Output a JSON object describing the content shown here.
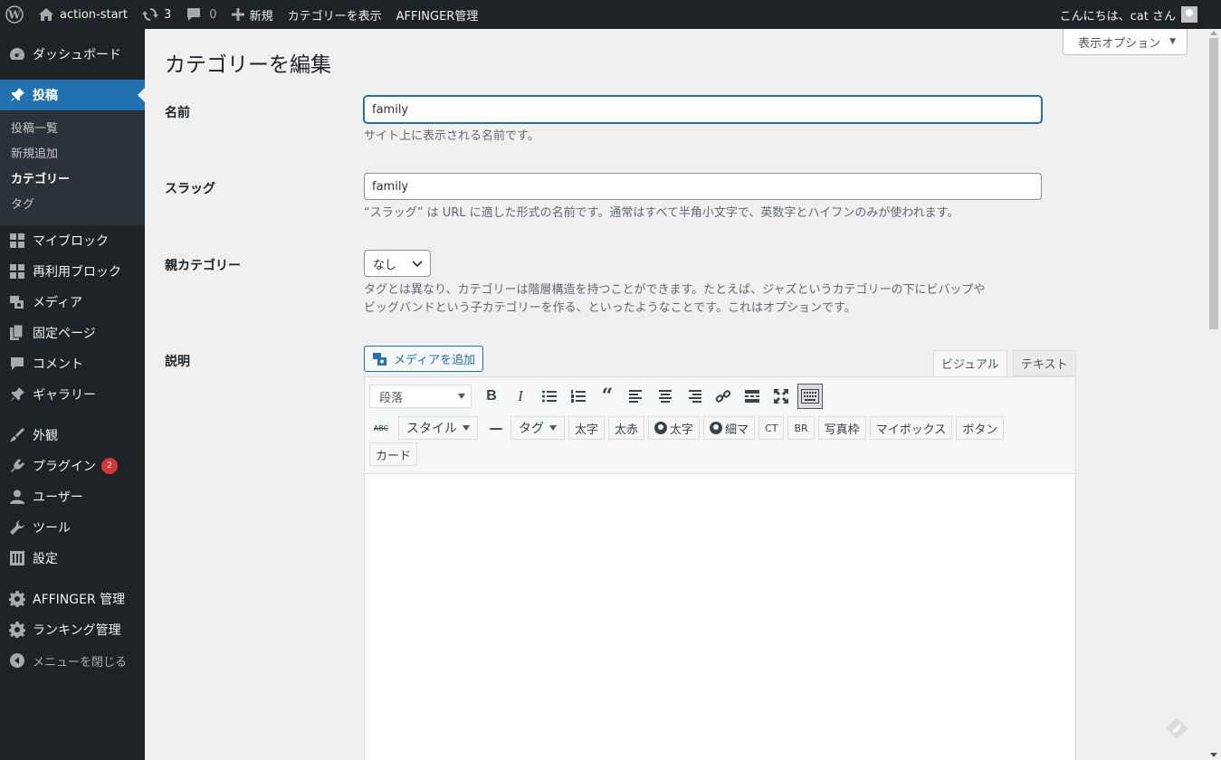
{
  "adminbar": {
    "site_name": "action-start",
    "updates_count": "3",
    "comments_count": "0",
    "new_label": "新規",
    "view_category": "カテゴリーを表示",
    "affinger": "AFFINGER管理",
    "greeting": "こんにちは、cat さん"
  },
  "sidebar": {
    "dashboard": "ダッシュボード",
    "posts": "投稿",
    "sub": {
      "all_posts": "投稿一覧",
      "add_new": "新規追加",
      "categories": "カテゴリー",
      "tags": "タグ"
    },
    "my_blocks": "マイブロック",
    "reusable_blocks": "再利用ブロック",
    "media": "メディア",
    "pages": "固定ページ",
    "comments": "コメント",
    "gallery": "ギャラリー",
    "appearance": "外観",
    "plugins": "プラグイン",
    "plugins_badge": "2",
    "users": "ユーザー",
    "tools": "ツール",
    "settings": "設定",
    "affinger": "AFFINGER 管理",
    "ranking": "ランキング管理",
    "collapse": "メニューを閉じる"
  },
  "main": {
    "screen_options": "表示オプション",
    "title": "カテゴリーを編集",
    "name": {
      "label": "名前",
      "value": "family",
      "desc": "サイト上に表示される名前です。"
    },
    "slug": {
      "label": "スラッグ",
      "value": "family",
      "desc": "“スラッグ” は URL に適した形式の名前です。通常はすべて半角小文字で、英数字とハイフンのみが使われます。"
    },
    "parent": {
      "label": "親カテゴリー",
      "selected": "なし",
      "desc_line1": "タグとは異なり、カテゴリーは階層構造を持つことができます。たとえば、ジャズというカテゴリーの下にビバップや",
      "desc_line2": "ビッグバンドという子カテゴリーを作る、といったようなことです。これはオプションです。"
    },
    "description": {
      "label": "説明",
      "add_media": "メディアを追加",
      "tab_visual": "ビジュアル",
      "tab_text": "テキスト",
      "format_select": "段落",
      "buttons": {
        "style": "スタイル",
        "tag": "タグ",
        "bold": "太字",
        "bold_red": "太赤",
        "person_bold": "太字",
        "person_thin": "細マ",
        "ct": "CT",
        "br": "BR",
        "photo_frame": "写真枠",
        "my_box": "マイボックス",
        "button": "ボタン",
        "card": "カード"
      },
      "strike_label": "ABC"
    }
  }
}
